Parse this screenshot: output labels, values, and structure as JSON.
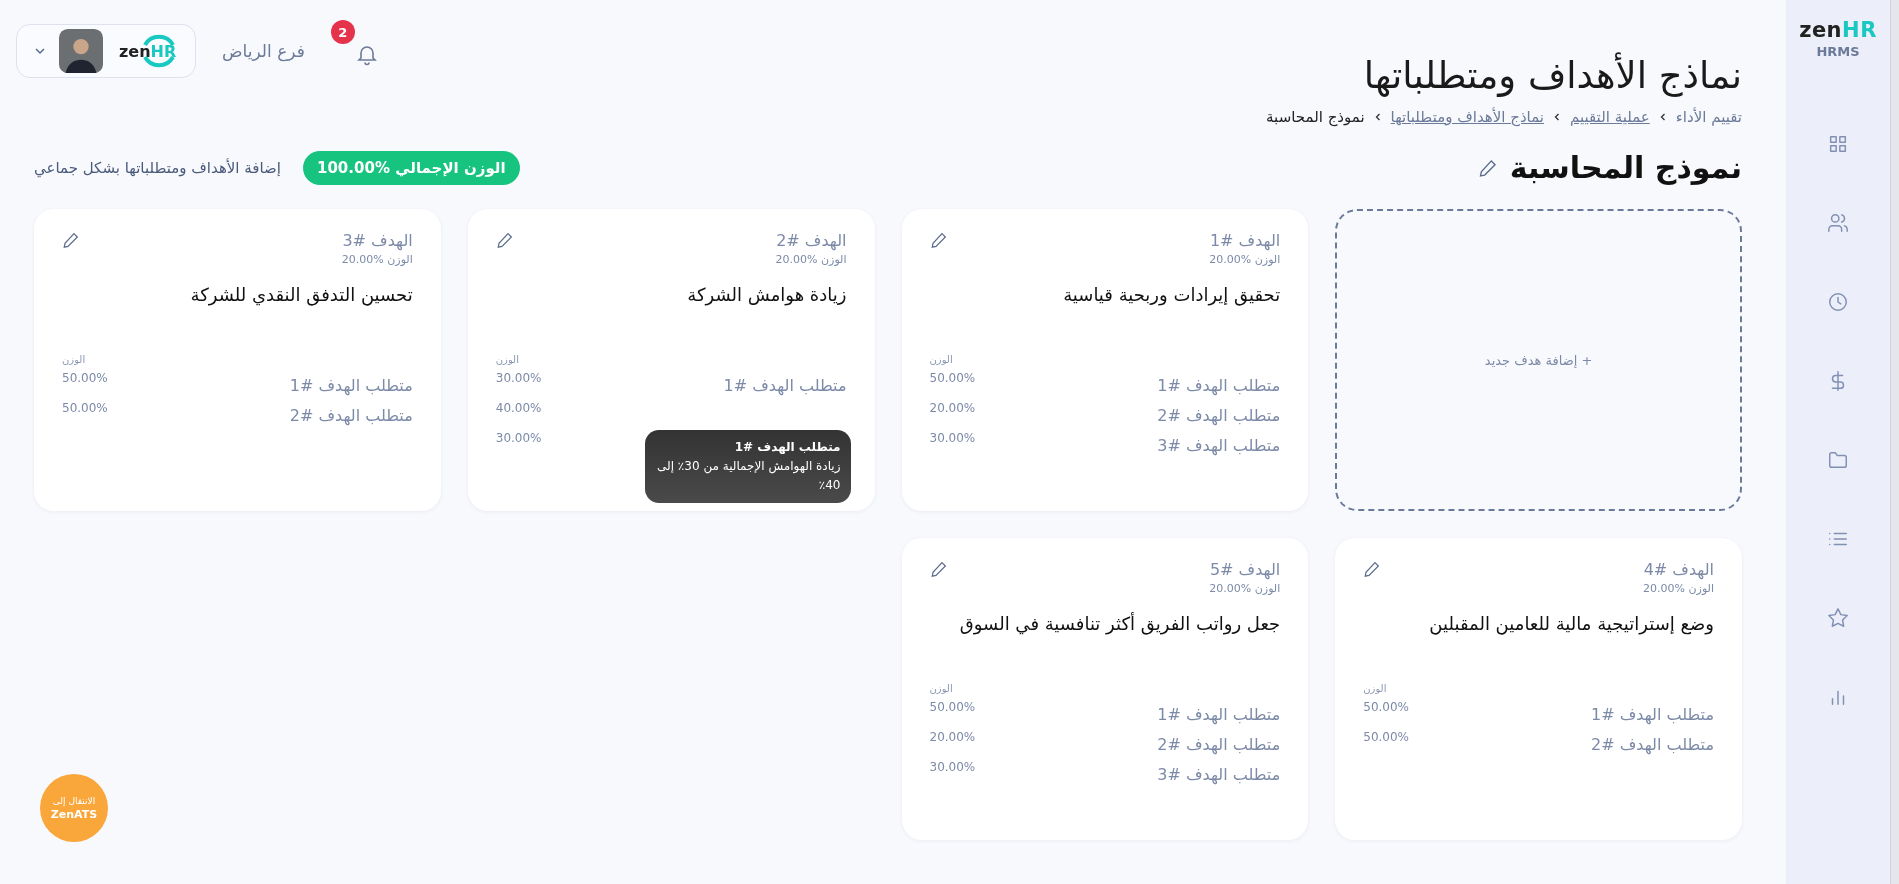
{
  "logo": {
    "word": "zen",
    "accent": "HR",
    "product": "HRMS"
  },
  "header": {
    "account_logo": {
      "word": "zen",
      "accent": "HR"
    },
    "branch": "فرع الرياض",
    "notifications": "2"
  },
  "title": "نماذج الأهداف ومتطلباتها",
  "breadcrumbs": [
    {
      "label": "تقييم الأداء",
      "kind": "plain"
    },
    {
      "label": "عملية التقييم",
      "kind": "link"
    },
    {
      "label": "نماذج الأهداف ومتطلباتها",
      "kind": "link"
    },
    {
      "label": "نموذج المحاسبة",
      "kind": "current"
    }
  ],
  "model": {
    "name": "نموذج المحاسبة",
    "total_weight": "الوزن الإجمالي %100.00",
    "bulk_add": "إضافة الأهداف ومتطلباتها بشكل جماعي"
  },
  "add_goal": "+ إضافة هدف جديد",
  "goals": [
    {
      "number": "الهدف #1",
      "weight": "الوزن %20.00",
      "title": "تحقيق إيرادات وربحية قياسية",
      "weight_heading": "الوزن",
      "requirements": [
        {
          "label": "متطلب الهدف #1",
          "weight": "50.00%"
        },
        {
          "label": "متطلب الهدف #2",
          "weight": "20.00%"
        },
        {
          "label": "متطلب الهدف #3",
          "weight": "30.00%"
        }
      ]
    },
    {
      "number": "الهدف #2",
      "weight": "الوزن %20.00",
      "title": "زيادة هوامش الشركة",
      "weight_heading": "الوزن",
      "requirements": [
        {
          "label": "متطلب الهدف #1",
          "weight": "30.00%"
        },
        {
          "weight": "40.00%"
        },
        {
          "weight": "30.00%"
        }
      ],
      "tooltip": {
        "title": "متطلب الهدف #1",
        "text": "زيادة الهوامش الإجمالية من 30٪ إلى 40٪"
      }
    },
    {
      "number": "الهدف #3",
      "weight": "الوزن %20.00",
      "title": "تحسين التدفق النقدي للشركة",
      "weight_heading": "الوزن",
      "requirements": [
        {
          "label": "متطلب الهدف #1",
          "weight": "50.00%"
        },
        {
          "label": "متطلب الهدف #2",
          "weight": "50.00%"
        }
      ]
    },
    {
      "number": "الهدف #4",
      "weight": "الوزن %20.00",
      "title": "وضع إستراتيجية مالية للعامين المقبلين",
      "weight_heading": "الوزن",
      "requirements": [
        {
          "label": "متطلب الهدف #1",
          "weight": "50.00%"
        },
        {
          "label": "متطلب الهدف #2",
          "weight": "50.00%"
        }
      ]
    },
    {
      "number": "الهدف #5",
      "weight": "الوزن %20.00",
      "title": "جعل رواتب الفريق أكثر تنافسية في السوق",
      "weight_heading": "الوزن",
      "requirements": [
        {
          "label": "متطلب الهدف #1",
          "weight": "50.00%"
        },
        {
          "label": "متطلب الهدف #2",
          "weight": "20.00%"
        },
        {
          "label": "متطلب الهدف #3",
          "weight": "30.00%"
        }
      ]
    }
  ],
  "ats_button": {
    "line1": "الانتقال إلى",
    "line2": "ZenATS"
  }
}
